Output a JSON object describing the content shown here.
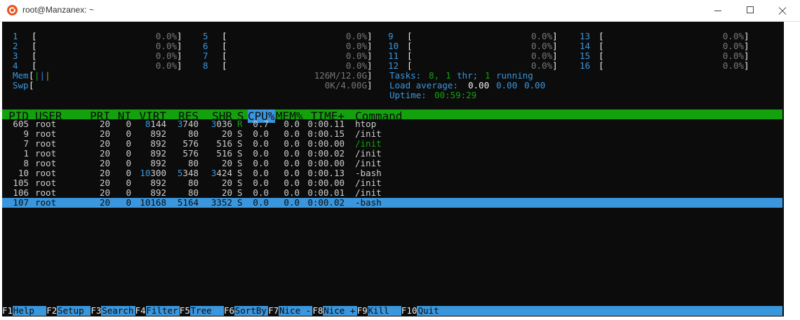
{
  "window": {
    "title": "root@Manzanex: ~"
  },
  "cpu_meters": [
    {
      "id": "1",
      "value": "0.0%"
    },
    {
      "id": "2",
      "value": "0.0%"
    },
    {
      "id": "3",
      "value": "0.0%"
    },
    {
      "id": "4",
      "value": "0.0%"
    },
    {
      "id": "5",
      "value": "0.0%"
    },
    {
      "id": "6",
      "value": "0.0%"
    },
    {
      "id": "7",
      "value": "0.0%"
    },
    {
      "id": "8",
      "value": "0.0%"
    },
    {
      "id": "9",
      "value": "0.0%"
    },
    {
      "id": "10",
      "value": "0.0%"
    },
    {
      "id": "11",
      "value": "0.0%"
    },
    {
      "id": "12",
      "value": "0.0%"
    },
    {
      "id": "13",
      "value": "0.0%"
    },
    {
      "id": "14",
      "value": "0.0%"
    },
    {
      "id": "15",
      "value": "0.0%"
    },
    {
      "id": "16",
      "value": "0.0%"
    }
  ],
  "mem": {
    "label": "Mem",
    "bars": "|||",
    "value": "126M/12.0G"
  },
  "swp": {
    "label": "Swp",
    "value": "0K/4.00G"
  },
  "tasks": {
    "label": "Tasks:",
    "count": "8,",
    "thr": "1",
    "thr_label": "thr;",
    "running": "1",
    "running_label": "running"
  },
  "load": {
    "label": "Load average:",
    "v1": "0.00",
    "v2": "0.00",
    "v3": "0.00"
  },
  "uptime": {
    "label": "Uptime:",
    "value": "00:59:29"
  },
  "columns": {
    "pid": "PID",
    "user": "USER",
    "pri": "PRI",
    "ni": "NI",
    "virt": "VIRT",
    "res": "RES",
    "shr": "SHR",
    "s": "S",
    "cpu": "CPU%",
    "mem": "MEM%",
    "time": "TIME+",
    "command": "Command"
  },
  "processes": [
    {
      "pid": "605",
      "user": "root",
      "pri": "20",
      "ni": "0",
      "virt_a": "8",
      "virt_b": "144",
      "res_a": "3",
      "res_b": "740",
      "shr_a": "3",
      "shr_b": "036",
      "s": "R",
      "cpu": "0.7",
      "mem": "0.0",
      "time": "0:00.11",
      "command": "htop"
    },
    {
      "pid": "9",
      "user": "root",
      "pri": "20",
      "ni": "0",
      "virt_a": "",
      "virt_b": "892",
      "res_a": "",
      "res_b": "80",
      "shr_a": "",
      "shr_b": "20",
      "s": "S",
      "cpu": "0.0",
      "mem": "0.0",
      "time": "0:00.15",
      "command": "/init"
    },
    {
      "pid": "7",
      "user": "root",
      "pri": "20",
      "ni": "0",
      "virt_a": "",
      "virt_b": "892",
      "res_a": "",
      "res_b": "576",
      "shr_a": "",
      "shr_b": "516",
      "s": "S",
      "cpu": "0.0",
      "mem": "0.0",
      "time": "0:00.00",
      "command": "/init"
    },
    {
      "pid": "1",
      "user": "root",
      "pri": "20",
      "ni": "0",
      "virt_a": "",
      "virt_b": "892",
      "res_a": "",
      "res_b": "576",
      "shr_a": "",
      "shr_b": "516",
      "s": "S",
      "cpu": "0.0",
      "mem": "0.0",
      "time": "0:00.02",
      "command": "/init"
    },
    {
      "pid": "8",
      "user": "root",
      "pri": "20",
      "ni": "0",
      "virt_a": "",
      "virt_b": "892",
      "res_a": "",
      "res_b": "80",
      "shr_a": "",
      "shr_b": "20",
      "s": "S",
      "cpu": "0.0",
      "mem": "0.0",
      "time": "0:00.00",
      "command": "/init"
    },
    {
      "pid": "10",
      "user": "root",
      "pri": "20",
      "ni": "0",
      "virt_a": "10",
      "virt_b": "300",
      "res_a": "5",
      "res_b": "348",
      "shr_a": "3",
      "shr_b": "424",
      "s": "S",
      "cpu": "0.0",
      "mem": "0.0",
      "time": "0:00.13",
      "command": "-bash"
    },
    {
      "pid": "105",
      "user": "root",
      "pri": "20",
      "ni": "0",
      "virt_a": "",
      "virt_b": "892",
      "res_a": "",
      "res_b": "80",
      "shr_a": "",
      "shr_b": "20",
      "s": "S",
      "cpu": "0.0",
      "mem": "0.0",
      "time": "0:00.00",
      "command": "/init"
    },
    {
      "pid": "106",
      "user": "root",
      "pri": "20",
      "ni": "0",
      "virt_a": "",
      "virt_b": "892",
      "res_a": "",
      "res_b": "80",
      "shr_a": "",
      "shr_b": "20",
      "s": "S",
      "cpu": "0.0",
      "mem": "0.0",
      "time": "0:00.01",
      "command": "/init"
    },
    {
      "pid": "107",
      "user": "root",
      "pri": "20",
      "ni": "0",
      "virt_a": "",
      "virt_b": "10168",
      "res_a": "",
      "res_b": "5164",
      "shr_a": "",
      "shr_b": "3352",
      "s": "S",
      "cpu": "0.0",
      "mem": "0.0",
      "time": "0:00.02",
      "command": "-bash",
      "selected": true
    }
  ],
  "function_keys": [
    {
      "key": "F1",
      "label": "Help"
    },
    {
      "key": "F2",
      "label": "Setup"
    },
    {
      "key": "F3",
      "label": "Search"
    },
    {
      "key": "F4",
      "label": "Filter"
    },
    {
      "key": "F5",
      "label": "Tree"
    },
    {
      "key": "F6",
      "label": "SortBy"
    },
    {
      "key": "F7",
      "label": "Nice -"
    },
    {
      "key": "F8",
      "label": "Nice +"
    },
    {
      "key": "F9",
      "label": "Kill"
    },
    {
      "key": "F10",
      "label": "Quit"
    }
  ],
  "colors": {
    "terminal_bg": "#0c0c0c",
    "header_green": "#13a10e",
    "select_blue": "#3a96dd"
  }
}
